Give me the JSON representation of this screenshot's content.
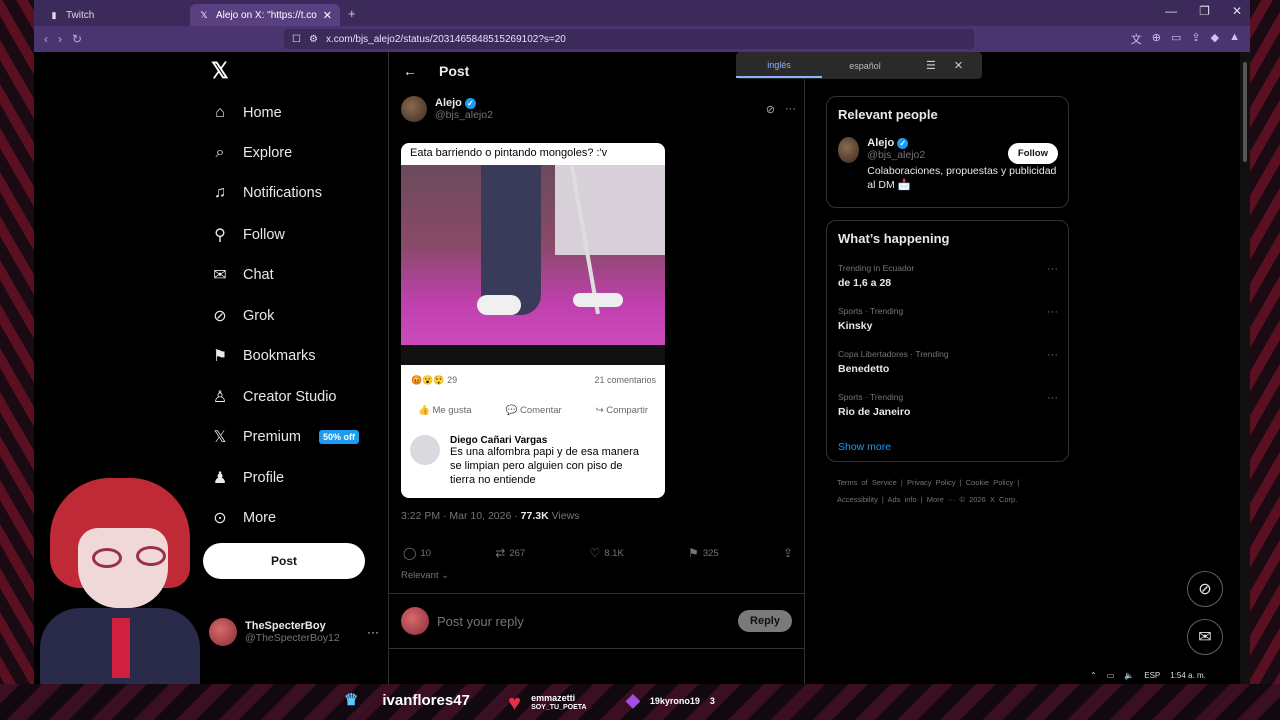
{
  "browser": {
    "tabs": [
      {
        "title": "Twitch",
        "icon": "twitch-icon"
      },
      {
        "title": "Alejo on X: \"https://t.co/nOENz",
        "icon": "x-icon",
        "active": true
      }
    ],
    "url": "x.com/bjs_alejo2/status/2031465848515269102?s=20"
  },
  "translate_popup": {
    "options": [
      "inglés",
      "español"
    ],
    "active": "inglés"
  },
  "nav": {
    "items": [
      {
        "label": "Home",
        "icon": "home-icon"
      },
      {
        "label": "Explore",
        "icon": "search-icon"
      },
      {
        "label": "Notifications",
        "icon": "bell-icon"
      },
      {
        "label": "Follow",
        "icon": "add-person-icon"
      },
      {
        "label": "Chat",
        "icon": "mail-icon"
      },
      {
        "label": "Grok",
        "icon": "grok-icon"
      },
      {
        "label": "Bookmarks",
        "icon": "bookmark-icon"
      },
      {
        "label": "Creator Studio",
        "icon": "creator-icon"
      },
      {
        "label": "Premium",
        "icon": "x-icon"
      },
      {
        "label": "Profile",
        "icon": "person-icon"
      },
      {
        "label": "More",
        "icon": "more-circle-icon"
      }
    ],
    "premium_badge": "50% off",
    "post_button": "Post"
  },
  "account": {
    "name": "TheSpecterBoy",
    "handle": "@TheSpecterBoy12"
  },
  "post": {
    "header_title": "Post",
    "author_name": "Alejo",
    "author_handle": "@bjs_alejo2",
    "media": {
      "caption": "Eata barriendo o pintando mongoles? :'v",
      "reactions": "29",
      "comments": "21 comentarios",
      "actions": [
        "Me gusta",
        "Comentar",
        "Compartir"
      ],
      "comment_author": "Diego Cañari Vargas",
      "comment_text": "Es una alfombra papi y de esa manera se limpian pero alguien con piso de tierra no entiende"
    },
    "time": "3:22 PM · Mar 10, 2026 ·",
    "views_count": "77.3K",
    "views_label": "Views",
    "stats": {
      "replies": "10",
      "reposts": "267",
      "likes": "8.1K",
      "bookmarks": "325"
    },
    "relevant_label": "Relevant",
    "reply_placeholder": "Post your reply",
    "reply_button": "Reply"
  },
  "relevant_people": {
    "title": "Relevant people",
    "name": "Alejo",
    "handle": "@bjs_alejo2",
    "bio": "Colaboraciones, propuestas y publicidad al DM 📩",
    "follow_button": "Follow"
  },
  "whats_happening": {
    "title": "What’s happening",
    "trends": [
      {
        "meta": "Trending in Ecuador",
        "name": "de 1,6 a 28"
      },
      {
        "meta": "Sports · Trending",
        "name": "Kinsky"
      },
      {
        "meta": "Copa Libertadores · Trending",
        "name": "Benedetto"
      },
      {
        "meta": "Sports · Trending",
        "name": "Rio de Janeiro"
      }
    ],
    "show_more": "Show more"
  },
  "footer": {
    "line1": "Terms of Service  |  Privacy Policy  |  Cookie Policy  |",
    "line2": "Accessibility  |  Ads info  |  More ···  © 2026 X Corp."
  },
  "taskbar": {
    "lang": "ESP",
    "clock": "1:54 a. m."
  },
  "stream_overlay": {
    "top_user": "ivanflores47",
    "heart_user": "emmazetti",
    "heart_sub": "SOY_TU_POETA",
    "gem_user": "19kyrono19",
    "gem_count": "3"
  },
  "colors": {
    "accent": "#1d9bf0",
    "background": "#000000",
    "tab_bar": "#3b2a5a"
  }
}
